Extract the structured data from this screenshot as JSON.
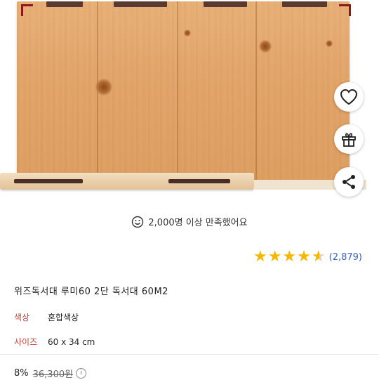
{
  "product_image": {
    "alt": "wooden reading stand board"
  },
  "actions": {
    "wishlist_icon": "heart-icon",
    "gift_icon": "gift-icon",
    "share_icon": "share-icon"
  },
  "satisfaction": {
    "icon": "smile-icon",
    "text": "2,000명 이상 만족했어요"
  },
  "rating": {
    "value": 4.5,
    "max": 5,
    "review_count": "(2,879)"
  },
  "product": {
    "title": "위즈독서대 루미60 2단 독서대 60M2",
    "options": [
      {
        "label": "색상",
        "value": "혼합색상"
      },
      {
        "label": "사이즈",
        "value": "60 x 34 cm"
      }
    ]
  },
  "price": {
    "discount": "8%",
    "original": "36,300원",
    "info_icon": "info-icon"
  },
  "colors": {
    "star": "#f5b800",
    "review_link": "#3a63c4",
    "option_label": "#c9453a"
  }
}
